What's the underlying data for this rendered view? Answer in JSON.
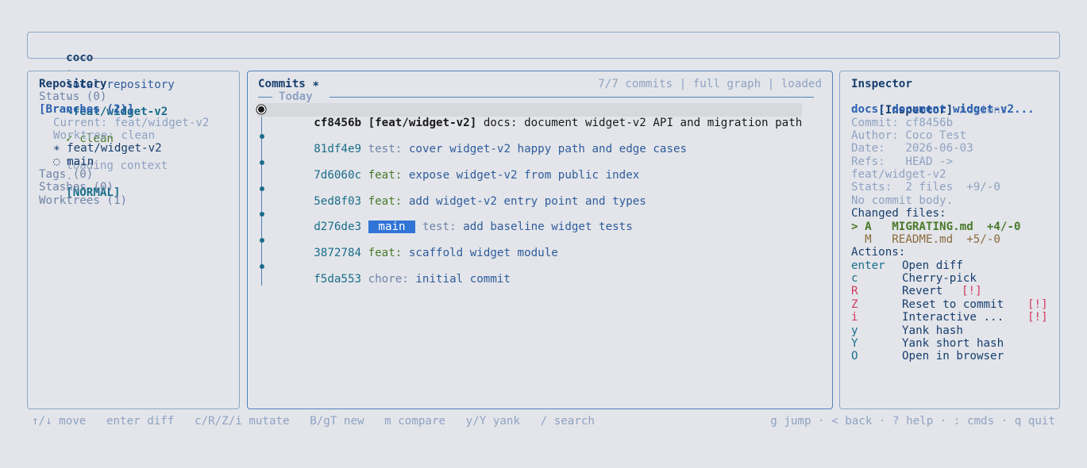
{
  "header": {
    "app": "coco",
    "sep": "·",
    "repo": "local repository",
    "branch_icon": "⌥",
    "branch": "feat/widget-v2",
    "status": "✓ clean",
    "loading": "loading context",
    "mode": "[NORMAL]"
  },
  "sidebar": {
    "title": "Repository",
    "status": "Status (0)",
    "branches": "[Branches (2)]",
    "current": "Current: feat/widget-v2",
    "worktree": "Worktree: clean",
    "branch_items": [
      "∗ feat/widget-v2",
      "◌ main"
    ],
    "tags": "Tags (0)",
    "stashes": "Stashes (0)",
    "worktrees": "Worktrees (1)"
  },
  "commits": {
    "title": "Commits ∗",
    "meta": "7/7 commits | full graph | loaded",
    "group": "Today",
    "rows": [
      {
        "hash": "cf8456b",
        "refs": "[feat/widget-v2]",
        "type": "docs:",
        "msg": "document widget-v2 API and migration path"
      },
      {
        "hash": "81df4e9",
        "refs": "",
        "type": "test:",
        "msg": "cover widget-v2 happy path and edge cases"
      },
      {
        "hash": "7d6060c",
        "refs": "",
        "type": "feat:",
        "msg": "expose widget-v2 from public index"
      },
      {
        "hash": "5ed8f03",
        "refs": "",
        "type": "feat:",
        "msg": "add widget-v2 entry point and types"
      },
      {
        "hash": "d276de3",
        "refs": "main",
        "type": "test:",
        "msg": "add baseline widget tests"
      },
      {
        "hash": "3872784",
        "refs": "",
        "type": "feat:",
        "msg": "scaffold widget module"
      },
      {
        "hash": "f5da553",
        "refs": "",
        "type": "chore:",
        "msg": "initial commit"
      }
    ]
  },
  "inspector": {
    "title": "Inspector",
    "tab_active": "[Inspector]",
    "tab_other": "Actions",
    "subject": "docs: document widget-v2...",
    "commit": "Commit: cf8456b",
    "author": "Author: Coco Test",
    "date": "Date:   2026-06-03",
    "refs1": "Refs:   HEAD ->",
    "refs2": "feat/widget-v2",
    "stats": "Stats:  2 files  +9/-0",
    "body": "No commit body.",
    "changed_label": "Changed files:",
    "files": [
      {
        "marker": "> A",
        "name": "MIGRATING.md",
        "delta": "+4/-0"
      },
      {
        "marker": "  M",
        "name": "README.md",
        "delta": "+5/-0"
      }
    ],
    "actions_label": "Actions:",
    "actions": [
      {
        "key": "enter",
        "label": "Open diff",
        "warn": ""
      },
      {
        "key": "c",
        "label": "Cherry-pick",
        "warn": ""
      },
      {
        "key": "R",
        "label": "Revert",
        "warn": "[!]"
      },
      {
        "key": "Z",
        "label": "Reset to commit",
        "warn": "[!]"
      },
      {
        "key": "i",
        "label": "Interactive ...",
        "warn": "[!]"
      },
      {
        "key": "y",
        "label": "Yank hash",
        "warn": ""
      },
      {
        "key": "Y",
        "label": "Yank short hash",
        "warn": ""
      },
      {
        "key": "O",
        "label": "Open in browser",
        "warn": ""
      }
    ]
  },
  "footer": {
    "left": "↑/↓ move   enter diff   c/R/Z/i mutate   B/gT new   m compare   y/Y yank   / search",
    "right": "g jump · < back · ? help · : cmds · q quit"
  },
  "colors": {
    "background": "#e3e5ea",
    "border": "#8ea6c6",
    "accent": "#2f74d6",
    "danger": "#d03a5e",
    "added": "#4a7a2a",
    "modified": "#8a6a3a"
  },
  "icons": {
    "branch": "branch-icon",
    "commit_node": "commit-node-icon"
  }
}
